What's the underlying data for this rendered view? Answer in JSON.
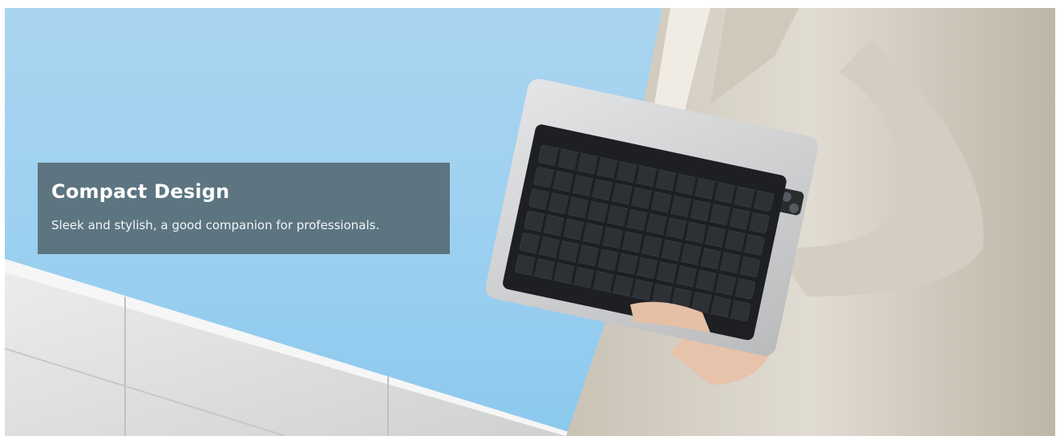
{
  "banner": {
    "title": "Compact Design",
    "subtitle": "Sleek and stylish, a good companion for professionals."
  },
  "image": {
    "description_icon": "tablet-keyboard-photo",
    "colors": {
      "sky": "#9fd1f0",
      "wall": "#e3e4e2",
      "suit": "#d8d3c8",
      "tablet": "#d3d4d5",
      "keyboard": "#1d1f22",
      "overlay": "#536870"
    }
  }
}
